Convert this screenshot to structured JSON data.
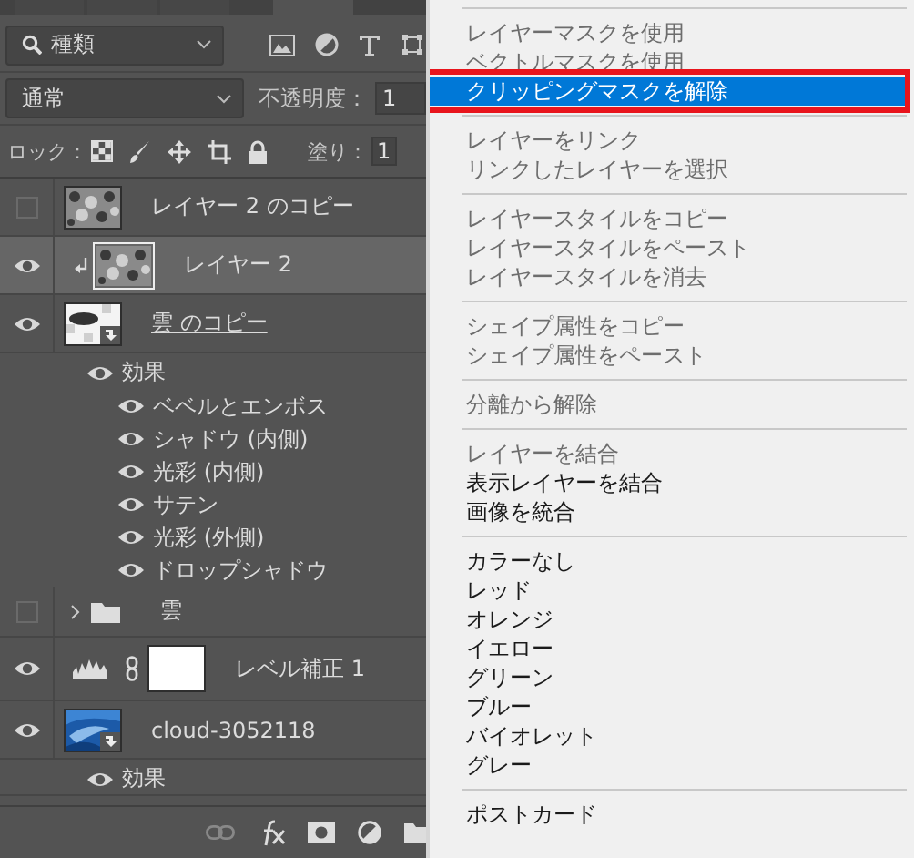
{
  "panel_tabs": [
    {
      "selected": false
    },
    {
      "selected": false
    },
    {
      "selected": false
    },
    {
      "selected": true
    }
  ],
  "filter": {
    "value": "種類"
  },
  "blend_mode": {
    "value": "通常"
  },
  "opacity": {
    "label": "不透明度：",
    "value": "1"
  },
  "lock": {
    "label": "ロック："
  },
  "fill": {
    "label": "塗り：",
    "value": "1"
  },
  "layers": [
    {
      "kind": "layer",
      "smart_object": false,
      "name": "レイヤー 2 のコピー",
      "visible": false,
      "selected": false,
      "clipped": false,
      "underlined": false
    },
    {
      "kind": "layer",
      "smart_object": false,
      "name": "レイヤー 2",
      "visible": true,
      "selected": true,
      "clipped": true,
      "underlined": false
    },
    {
      "kind": "layer",
      "smart_object": true,
      "name": "雲 のコピー",
      "visible": true,
      "selected": false,
      "clipped": false,
      "underlined": true,
      "effects": {
        "label": "効果",
        "visible": true,
        "children": [
          {
            "name": "ベベルとエンボス",
            "visible": true
          },
          {
            "name": "シャドウ (内側)",
            "visible": true
          },
          {
            "name": "光彩 (内側)",
            "visible": true
          },
          {
            "name": "サテン",
            "visible": true
          },
          {
            "name": "光彩 (外側)",
            "visible": true
          },
          {
            "name": "ドロップシャドウ",
            "visible": true
          }
        ]
      }
    },
    {
      "kind": "group",
      "name": "雲",
      "visible": false,
      "selected": false,
      "expanded": false
    },
    {
      "kind": "adjustment",
      "name": "レベル補正 1",
      "visible": true,
      "selected": false
    },
    {
      "kind": "layer",
      "smart_object": true,
      "name": "cloud-3052118",
      "visible": true,
      "selected": false,
      "clipped": false,
      "underlined": false,
      "effects": {
        "label": "効果",
        "visible": true
      }
    }
  ],
  "menu": [
    {
      "kind": "separator"
    },
    {
      "kind": "item",
      "label": "レイヤーマスクを使用",
      "disabled": true,
      "selected": false,
      "annotated": false
    },
    {
      "kind": "item",
      "label": "ベクトルマスクを使用",
      "disabled": true,
      "selected": false,
      "annotated": false
    },
    {
      "kind": "item",
      "label": "クリッピングマスクを解除",
      "disabled": false,
      "selected": true,
      "annotated": true
    },
    {
      "kind": "separator"
    },
    {
      "kind": "item",
      "label": "レイヤーをリンク",
      "disabled": true,
      "selected": false,
      "annotated": false
    },
    {
      "kind": "item",
      "label": "リンクしたレイヤーを選択",
      "disabled": true,
      "selected": false,
      "annotated": false
    },
    {
      "kind": "separator"
    },
    {
      "kind": "item",
      "label": "レイヤースタイルをコピー",
      "disabled": true,
      "selected": false,
      "annotated": false
    },
    {
      "kind": "item",
      "label": "レイヤースタイルをペースト",
      "disabled": true,
      "selected": false,
      "annotated": false
    },
    {
      "kind": "item",
      "label": "レイヤースタイルを消去",
      "disabled": true,
      "selected": false,
      "annotated": false
    },
    {
      "kind": "separator"
    },
    {
      "kind": "item",
      "label": "シェイプ属性をコピー",
      "disabled": true,
      "selected": false,
      "annotated": false
    },
    {
      "kind": "item",
      "label": "シェイプ属性をペースト",
      "disabled": true,
      "selected": false,
      "annotated": false
    },
    {
      "kind": "separator"
    },
    {
      "kind": "item",
      "label": "分離から解除",
      "disabled": true,
      "selected": false,
      "annotated": false
    },
    {
      "kind": "separator"
    },
    {
      "kind": "item",
      "label": "レイヤーを結合",
      "disabled": true,
      "selected": false,
      "annotated": false
    },
    {
      "kind": "item",
      "label": "表示レイヤーを結合",
      "disabled": false,
      "selected": false,
      "annotated": false
    },
    {
      "kind": "item",
      "label": "画像を統合",
      "disabled": false,
      "selected": false,
      "annotated": false
    },
    {
      "kind": "separator"
    },
    {
      "kind": "item",
      "label": "カラーなし",
      "disabled": false,
      "selected": false,
      "annotated": false
    },
    {
      "kind": "item",
      "label": "レッド",
      "disabled": false,
      "selected": false,
      "annotated": false
    },
    {
      "kind": "item",
      "label": "オレンジ",
      "disabled": false,
      "selected": false,
      "annotated": false
    },
    {
      "kind": "item",
      "label": "イエロー",
      "disabled": false,
      "selected": false,
      "annotated": false
    },
    {
      "kind": "item",
      "label": "グリーン",
      "disabled": false,
      "selected": false,
      "annotated": false
    },
    {
      "kind": "item",
      "label": "ブルー",
      "disabled": false,
      "selected": false,
      "annotated": false
    },
    {
      "kind": "item",
      "label": "バイオレット",
      "disabled": false,
      "selected": false,
      "annotated": false
    },
    {
      "kind": "item",
      "label": "グレー",
      "disabled": false,
      "selected": false,
      "annotated": false
    },
    {
      "kind": "separator"
    },
    {
      "kind": "item",
      "label": "ポストカード",
      "disabled": false,
      "selected": false,
      "annotated": false
    }
  ]
}
